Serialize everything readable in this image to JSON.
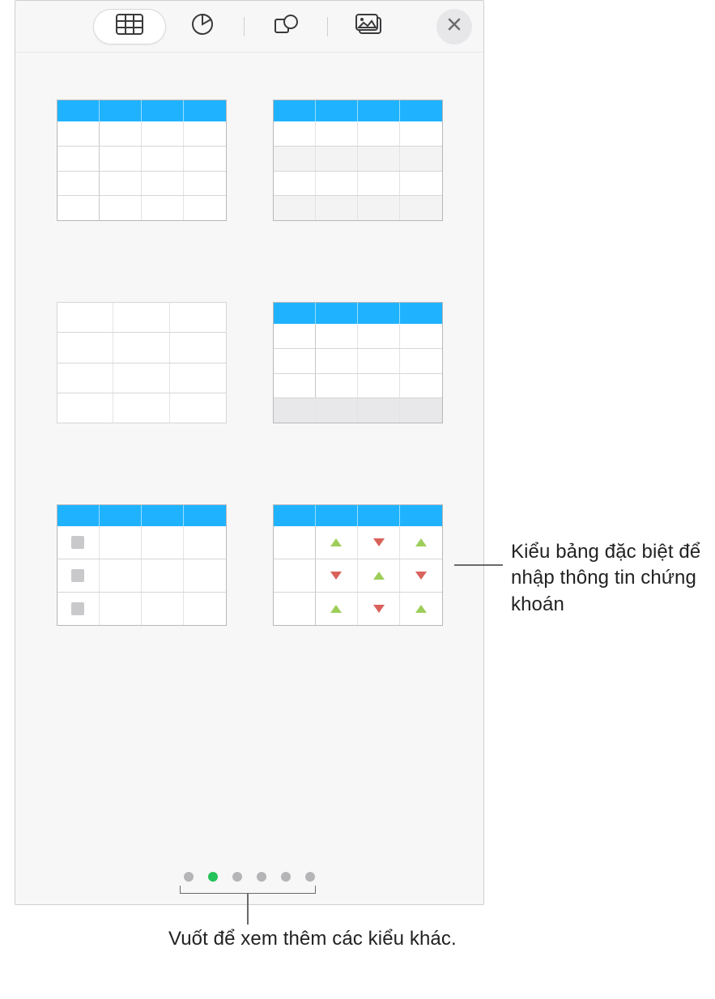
{
  "toolbar": {
    "tabs": [
      {
        "name": "table-tab",
        "icon": "table-icon",
        "active": true
      },
      {
        "name": "chart-tab",
        "icon": "pie-chart-icon",
        "active": false
      },
      {
        "name": "shape-tab",
        "icon": "shapes-icon",
        "active": false
      },
      {
        "name": "media-tab",
        "icon": "media-icon",
        "active": false
      }
    ],
    "close": "close"
  },
  "styles": [
    {
      "name": "table-style-1",
      "header": "blue",
      "rows": 4,
      "cols": 4,
      "rowHeader": true,
      "alt": false
    },
    {
      "name": "table-style-2",
      "header": "blue",
      "rows": 4,
      "cols": 4,
      "rowHeader": false,
      "alt": true
    },
    {
      "name": "table-style-3",
      "header": "plain",
      "rows": 4,
      "cols": 3,
      "rowHeader": false,
      "alt": false
    },
    {
      "name": "table-style-4",
      "header": "blue",
      "rows": 3,
      "cols": 4,
      "rowHeader": true,
      "alt": false,
      "footer": true
    },
    {
      "name": "table-style-5",
      "header": "blue",
      "rows": 3,
      "cols": 4,
      "rowHeader": false,
      "alt": false,
      "checkboxes": true
    },
    {
      "name": "table-style-6",
      "header": "blue",
      "rows": 3,
      "cols": 4,
      "rowHeader": true,
      "alt": false,
      "stock": true
    }
  ],
  "pager": {
    "count": 6,
    "active_index": 1
  },
  "callouts": {
    "stock": "Kiểu bảng đặc biệt để nhập thông tin chứng khoán",
    "swipe": "Vuốt để xem thêm các kiểu khác."
  },
  "colors": {
    "accent": "#1fb3ff",
    "page_active": "#24c35a",
    "up": "#9ece5a",
    "down": "#d9625b"
  }
}
